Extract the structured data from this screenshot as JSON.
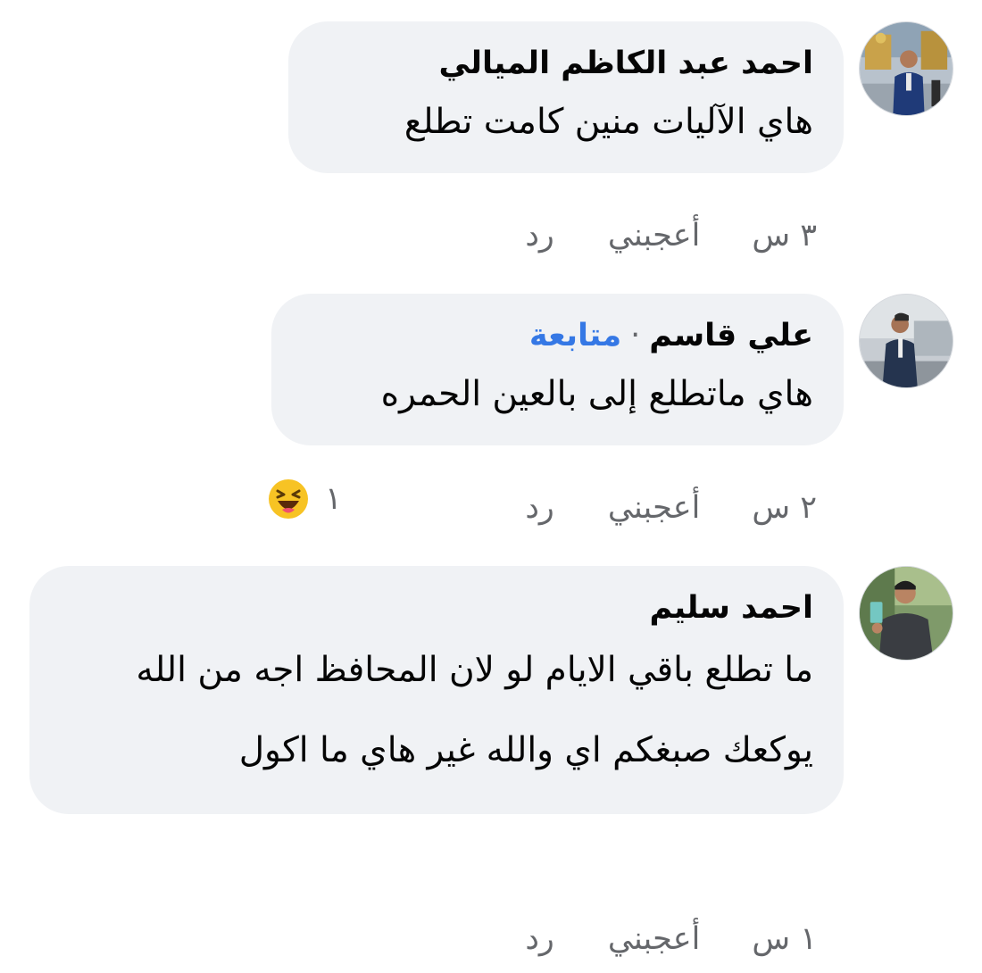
{
  "comments": [
    {
      "author": "احمد عبد الكاظم الميالي",
      "text": "هاي الآليات منين كامت تطلع",
      "time": "٣ س",
      "like_label": "أعجبني",
      "reply_label": "رد"
    },
    {
      "author": "علي قاسم",
      "separator": "·",
      "follow_label": "متابعة",
      "text": "هاي ماتطلع إلى بالعين الحمره",
      "time": "٢ س",
      "like_label": "أعجبني",
      "reply_label": "رد",
      "reaction": {
        "icon": "haha-emoji-icon",
        "count": "١"
      }
    },
    {
      "author": "احمد سليم",
      "text": "ما تطلع باقي الايام لو لان المحافظ اجه من الله يوكعك صبغكم اي والله غير هاي ما اكول",
      "time": "١ س",
      "like_label": "أعجبني",
      "reply_label": "رد"
    }
  ],
  "colors": {
    "bubble_bg": "#f0f2f5",
    "meta_text": "#65676b",
    "follow_link": "#3578e5",
    "reaction_yellow": "#f7c324"
  }
}
